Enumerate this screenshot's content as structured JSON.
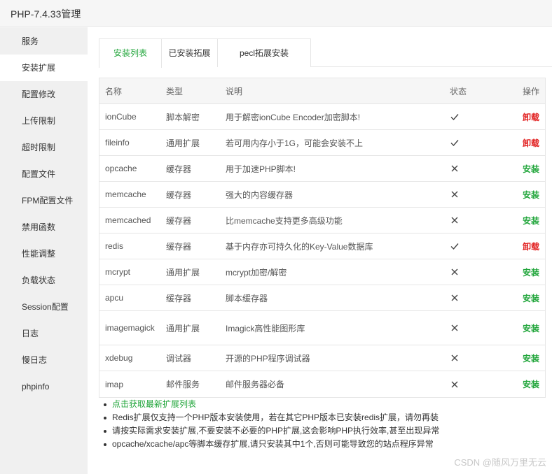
{
  "window": {
    "title": "PHP-7.4.33管理"
  },
  "sidebar": {
    "items": [
      {
        "label": "服务"
      },
      {
        "label": "安装扩展"
      },
      {
        "label": "配置修改"
      },
      {
        "label": "上传限制"
      },
      {
        "label": "超时限制"
      },
      {
        "label": "配置文件"
      },
      {
        "label": "FPM配置文件"
      },
      {
        "label": "禁用函数"
      },
      {
        "label": "性能调整"
      },
      {
        "label": "负载状态"
      },
      {
        "label": "Session配置"
      },
      {
        "label": "日志"
      },
      {
        "label": "慢日志"
      },
      {
        "label": "phpinfo"
      }
    ],
    "active_index": 1
  },
  "tabs": [
    {
      "label": "安装列表",
      "active": true
    },
    {
      "label": "已安装拓展",
      "active": false
    },
    {
      "label": "pecl拓展安装",
      "active": false
    }
  ],
  "table": {
    "headers": {
      "name": "名称",
      "type": "类型",
      "desc": "说明",
      "status": "状态",
      "op": "操作"
    },
    "rows": [
      {
        "name": "ionCube",
        "type": "脚本解密",
        "desc": "用于解密ionCube Encoder加密脚本!",
        "installed": true,
        "op": "卸载"
      },
      {
        "name": "fileinfo",
        "type": "通用扩展",
        "desc": "若可用内存小于1G，可能会安装不上",
        "installed": true,
        "op": "卸载"
      },
      {
        "name": "opcache",
        "type": "缓存器",
        "desc": "用于加速PHP脚本!",
        "installed": false,
        "op": "安装"
      },
      {
        "name": "memcache",
        "type": "缓存器",
        "desc": "强大的内容缓存器",
        "installed": false,
        "op": "安装"
      },
      {
        "name": "memcached",
        "type": "缓存器",
        "desc": "比memcache支持更多高级功能",
        "installed": false,
        "op": "安装"
      },
      {
        "name": "redis",
        "type": "缓存器",
        "desc": "基于内存亦可持久化的Key-Value数据库",
        "installed": true,
        "op": "卸载"
      },
      {
        "name": "mcrypt",
        "type": "通用扩展",
        "desc": "mcrypt加密/解密",
        "installed": false,
        "op": "安装"
      },
      {
        "name": "apcu",
        "type": "缓存器",
        "desc": "脚本缓存器",
        "installed": false,
        "op": "安装"
      },
      {
        "name": "imagemagick",
        "type": "通用扩展",
        "desc": "Imagick高性能图形库",
        "installed": false,
        "op": "安装"
      },
      {
        "name": "xdebug",
        "type": "调试器",
        "desc": "开源的PHP程序调试器",
        "installed": false,
        "op": "安装"
      },
      {
        "name": "imap",
        "type": "邮件服务",
        "desc": "邮件服务器必备",
        "installed": false,
        "op": "安装"
      }
    ]
  },
  "notes": {
    "link": "点击获取最新扩展列表",
    "items": [
      "Redis扩展仅支持一个PHP版本安装使用，若在其它PHP版本已安装redis扩展，请勿再装",
      "请按实际需求安装扩展,不要安装不必要的PHP扩展,这会影响PHP执行效率,甚至出现异常",
      "opcache/xcache/apc等脚本缓存扩展,请只安装其中1个,否则可能导致您的站点程序异常"
    ]
  },
  "watermark": "CSDN @随风万里无云",
  "colors": {
    "accent": "#20a53a",
    "danger": "#e11d1d"
  },
  "icons": {
    "installed": "check-icon",
    "not_installed": "cross-icon"
  }
}
